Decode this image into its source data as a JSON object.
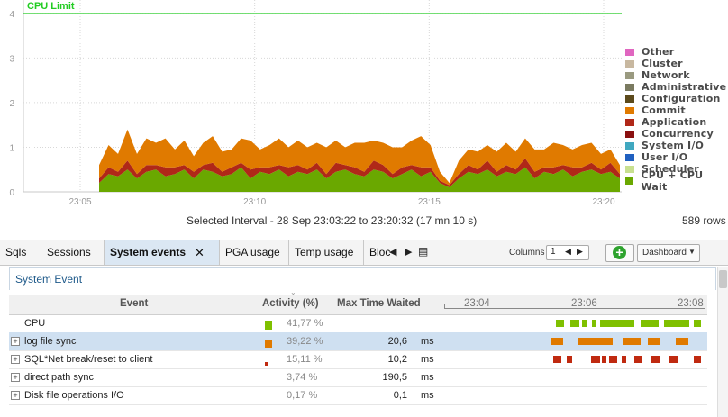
{
  "chart_data": {
    "type": "area",
    "y_ticks": [
      "0",
      "1",
      "2",
      "3",
      "4"
    ],
    "x_ticks": [
      "23:05",
      "23:10",
      "23:15",
      "23:20"
    ],
    "ylim": [
      0,
      4.3
    ],
    "limit_line": {
      "label": "CPU Limit",
      "value": 4,
      "color": "#22cc22"
    },
    "legend_position": "right",
    "legend": [
      {
        "name": "Other",
        "color": "#e066c0"
      },
      {
        "name": "Cluster",
        "color": "#c8b8a0"
      },
      {
        "name": "Network",
        "color": "#9a9a80"
      },
      {
        "name": "Administrative",
        "color": "#7a7a60"
      },
      {
        "name": "Configuration",
        "color": "#5c4a1c"
      },
      {
        "name": "Commit",
        "color": "#e07a00"
      },
      {
        "name": "Application",
        "color": "#b02818"
      },
      {
        "name": "Concurrency",
        "color": "#8a1010"
      },
      {
        "name": "System I/O",
        "color": "#40a8c0"
      },
      {
        "name": "User I/O",
        "color": "#2060c0"
      },
      {
        "name": "Scheduler",
        "color": "#c8e090"
      },
      {
        "name": "CPU + CPU Wait",
        "color": "#6aa800"
      }
    ],
    "series": [
      {
        "name": "CPU + CPU Wait",
        "color": "#6aa800",
        "values": [
          0.2,
          0.4,
          0.35,
          0.5,
          0.3,
          0.45,
          0.5,
          0.35,
          0.4,
          0.5,
          0.3,
          0.5,
          0.45,
          0.35,
          0.4,
          0.55,
          0.3,
          0.45,
          0.4,
          0.5,
          0.35,
          0.45,
          0.4,
          0.5,
          0.3,
          0.45,
          0.5,
          0.4,
          0.35,
          0.5,
          0.45,
          0.3,
          0.4,
          0.5,
          0.35,
          0.45,
          0.2,
          0.1,
          0.3,
          0.45,
          0.4,
          0.5,
          0.35,
          0.45,
          0.4,
          0.55,
          0.3,
          0.45,
          0.4,
          0.5,
          0.35,
          0.45,
          0.5,
          0.4,
          0.45,
          0.3
        ]
      },
      {
        "name": "Application",
        "color": "#b02818",
        "values": [
          0.1,
          0.15,
          0.1,
          0.2,
          0.1,
          0.15,
          0.1,
          0.2,
          0.15,
          0.1,
          0.15,
          0.1,
          0.2,
          0.1,
          0.15,
          0.1,
          0.2,
          0.1,
          0.15,
          0.1,
          0.2,
          0.15,
          0.1,
          0.15,
          0.1,
          0.2,
          0.1,
          0.15,
          0.1,
          0.2,
          0.15,
          0.1,
          0.15,
          0.1,
          0.2,
          0.1,
          0.05,
          0.05,
          0.1,
          0.15,
          0.1,
          0.2,
          0.1,
          0.15,
          0.1,
          0.2,
          0.15,
          0.1,
          0.15,
          0.1,
          0.2,
          0.1,
          0.15,
          0.1,
          0.2,
          0.1
        ]
      },
      {
        "name": "Commit",
        "color": "#e07a00",
        "values": [
          0.3,
          0.5,
          0.4,
          0.7,
          0.45,
          0.6,
          0.5,
          0.65,
          0.4,
          0.55,
          0.35,
          0.5,
          0.6,
          0.45,
          0.4,
          0.55,
          0.65,
          0.4,
          0.5,
          0.6,
          0.45,
          0.55,
          0.5,
          0.45,
          0.6,
          0.5,
          0.4,
          0.55,
          0.65,
          0.45,
          0.5,
          0.6,
          0.45,
          0.55,
          0.7,
          0.5,
          0.2,
          0.05,
          0.3,
          0.35,
          0.4,
          0.35,
          0.45,
          0.5,
          0.4,
          0.45,
          0.5,
          0.4,
          0.55,
          0.45,
          0.4,
          0.5,
          0.45,
          0.35,
          0.3,
          0.2
        ]
      }
    ]
  },
  "interval": {
    "label": "Selected Interval  -   28 Sep 23:03:22 to 23:20:32 (17 mn 10 s)",
    "rows": "589 rows"
  },
  "tabs": [
    {
      "label": "Sqls"
    },
    {
      "label": "Sessions"
    },
    {
      "label": "System events"
    },
    {
      "label": "PGA usage"
    },
    {
      "label": "Temp usage"
    },
    {
      "label": "Bloc"
    }
  ],
  "toolbar": {
    "columns_label": "Columns",
    "columns_value": "1",
    "dashboard_label": "Dashboard"
  },
  "section": {
    "title": "System Event"
  },
  "table": {
    "headers": {
      "event": "Event",
      "activity": "Activity (%)",
      "max_wait": "Max Time Waited"
    },
    "time_ticks": [
      "23:04",
      "23:06",
      "23:08"
    ],
    "rows": [
      {
        "event": "CPU",
        "activity": "41,77 %",
        "max_wait": "",
        "unit": "",
        "bar_color": "#7fc000",
        "bar_fraction": 0.4177,
        "expandable": false,
        "selected": false
      },
      {
        "event": "log file sync",
        "activity": "39,22 %",
        "max_wait": "20,6",
        "unit": "ms",
        "bar_color": "#e07a00",
        "bar_fraction": 0.3922,
        "expandable": true,
        "selected": true
      },
      {
        "event": "SQL*Net break/reset to client",
        "activity": "15,11 %",
        "max_wait": "10,2",
        "unit": "ms",
        "bar_color": "#c02a10",
        "bar_fraction": 0.1511,
        "expandable": true,
        "selected": false
      },
      {
        "event": "direct path sync",
        "activity": "3,74 %",
        "max_wait": "190,5",
        "unit": "ms",
        "bar_color": "#6aa800",
        "bar_fraction": 0.0374,
        "expandable": true,
        "selected": false
      },
      {
        "event": "Disk file operations I/O",
        "activity": "0,17 %",
        "max_wait": "0,1",
        "unit": "ms",
        "bar_color": "#6aa800",
        "bar_fraction": 0.0017,
        "expandable": true,
        "selected": false
      }
    ]
  }
}
